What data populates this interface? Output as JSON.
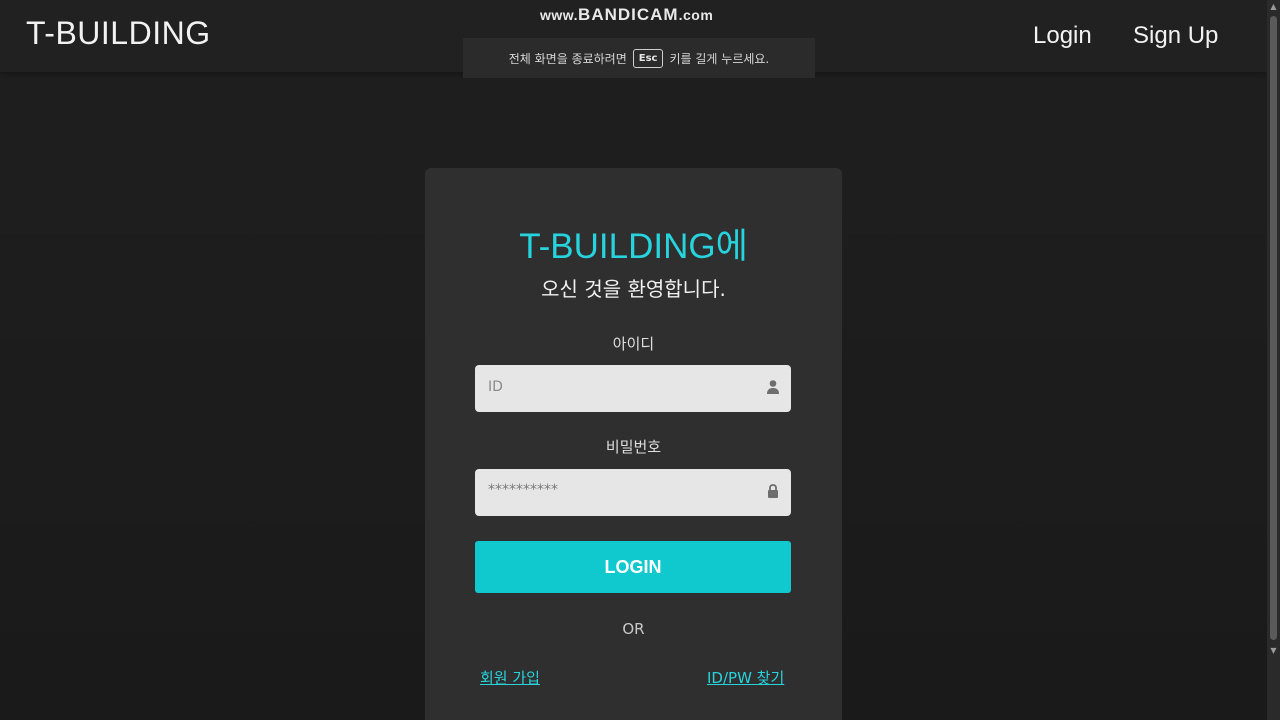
{
  "header": {
    "brand": "T-BUILDING",
    "nav": {
      "login": "Login",
      "signup": "Sign Up"
    }
  },
  "overlay": {
    "watermark_prefix": "www.",
    "watermark_main": "BANDICAM",
    "watermark_suffix": ".com",
    "notice_before": "전체 화면을 종료하려면",
    "esc_key": "Esc",
    "notice_after": "키를 길게 누르세요."
  },
  "login_card": {
    "title": "T-BUILDING에",
    "subtitle": "오신 것을 환영합니다.",
    "id_label": "아이디",
    "id_placeholder": "ID",
    "pw_label": "비밀번호",
    "pw_value": "**********",
    "login_button": "LOGIN",
    "or_text": "OR",
    "signup_link": "회원 가입",
    "find_link": "ID/PW 찾기"
  },
  "colors": {
    "accent": "#0fc9cf",
    "title_accent": "#27d3dc",
    "background": "#1d1d1d",
    "card": "#2f2f2f"
  },
  "icons": {
    "id_field": "user-icon",
    "pw_field": "lock-icon"
  }
}
